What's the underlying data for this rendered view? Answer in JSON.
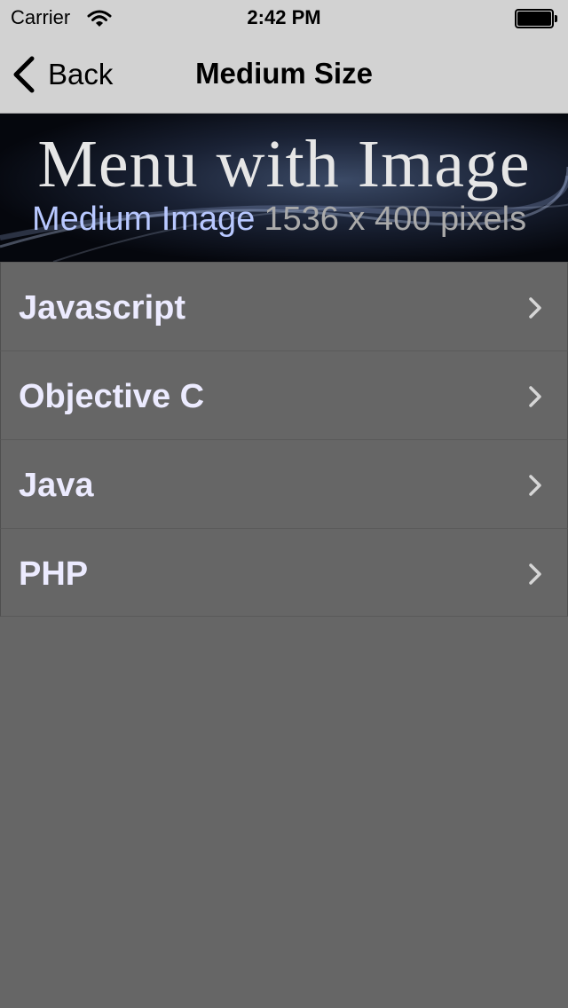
{
  "status_bar": {
    "carrier": "Carrier",
    "time": "2:42 PM",
    "icons": [
      "wifi-icon",
      "battery-icon"
    ]
  },
  "nav": {
    "back_label": "Back",
    "title": "Medium Size"
  },
  "banner": {
    "title": "Menu with Image",
    "subtitle_part1": "Medium Image",
    "subtitle_part2": "1536 x 400 pixels"
  },
  "menu": {
    "items": [
      {
        "label": "Javascript"
      },
      {
        "label": "Objective C"
      },
      {
        "label": "Java"
      },
      {
        "label": "PHP"
      }
    ]
  },
  "colors": {
    "background": "#666666",
    "bar": "#d2d2d2",
    "item_text": "#ecebff",
    "subtitle_accent": "#b8c8ff"
  }
}
